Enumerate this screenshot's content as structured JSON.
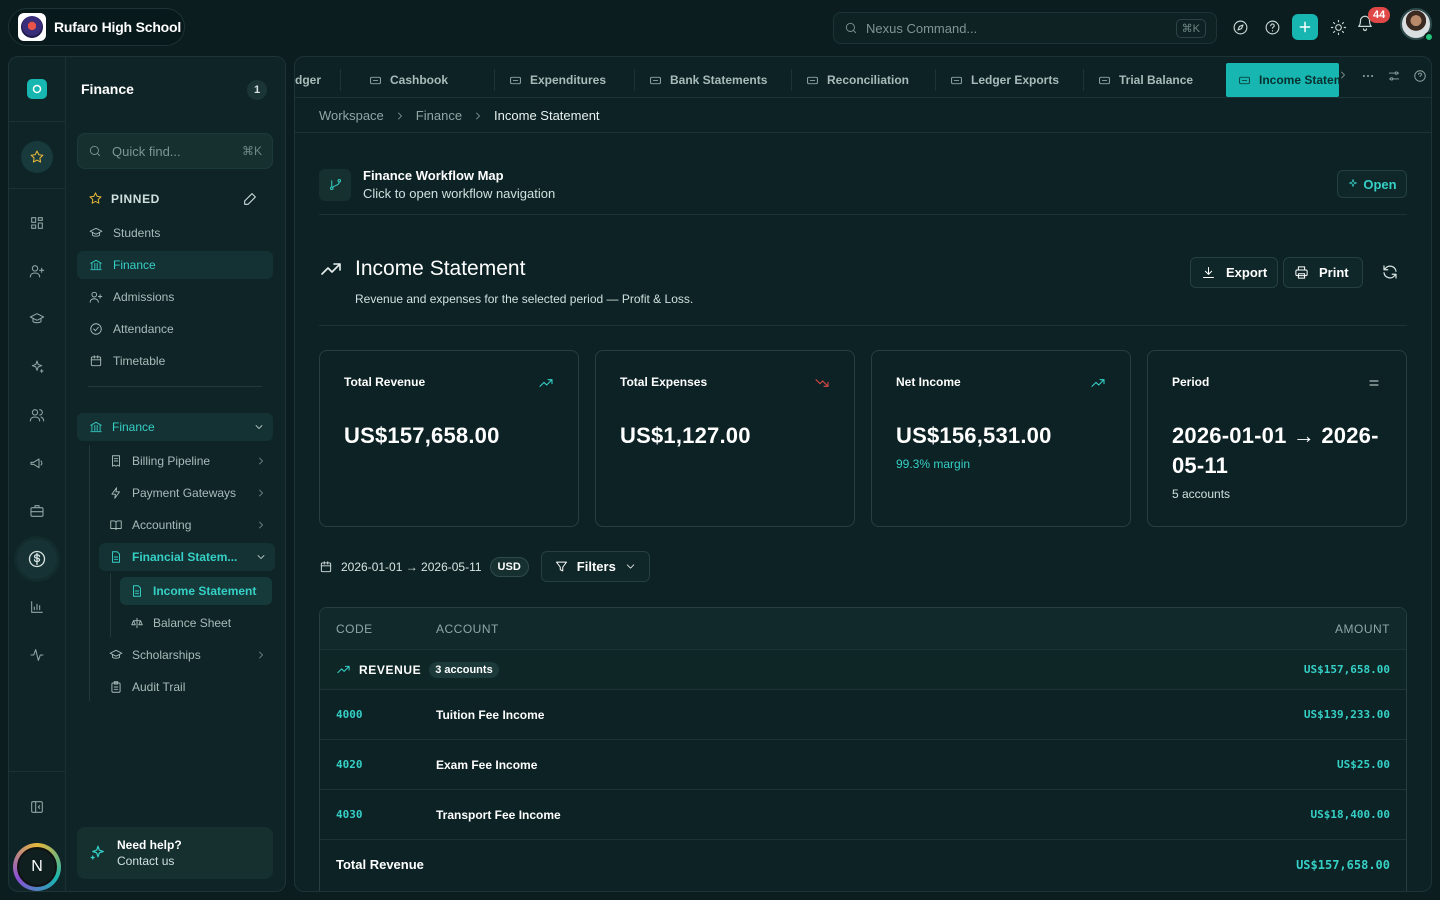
{
  "topbar": {
    "school_name": "Rufaro High School",
    "command_placeholder": "Nexus Command...",
    "command_shortcut": "⌘K",
    "notification_count": "44"
  },
  "nav": {
    "title": "Finance",
    "badge": "1",
    "quick_placeholder": "Quick find...",
    "quick_shortcut": "⌘K",
    "pinned_label": "PINNED",
    "pinned": [
      {
        "label": "Students",
        "icon": "graduation-cap-icon"
      },
      {
        "label": "Finance",
        "icon": "bank-icon"
      },
      {
        "label": "Admissions",
        "icon": "user-plus-icon"
      },
      {
        "label": "Attendance",
        "icon": "check-circle-icon"
      },
      {
        "label": "Timetable",
        "icon": "calendar-icon"
      }
    ],
    "group_label": "Finance",
    "tree": [
      {
        "label": "Billing Pipeline"
      },
      {
        "label": "Payment Gateways"
      },
      {
        "label": "Accounting"
      },
      {
        "label": "Financial Statem..."
      },
      {
        "label": "Income Statement"
      },
      {
        "label": "Balance Sheet"
      },
      {
        "label": "Scholarships"
      },
      {
        "label": "Audit Trail"
      }
    ],
    "help_title": "Need help?",
    "help_sub": "Contact us",
    "user_initial": "N"
  },
  "tabs": [
    {
      "label": "dger"
    },
    {
      "label": "Cashbook"
    },
    {
      "label": "Expenditures"
    },
    {
      "label": "Bank Statements"
    },
    {
      "label": "Reconciliation"
    },
    {
      "label": "Ledger Exports"
    },
    {
      "label": "Trial Balance"
    },
    {
      "label": "Income Statem"
    }
  ],
  "breadcrumb": [
    "Workspace",
    "Finance",
    "Income Statement"
  ],
  "workflow": {
    "title": "Finance Workflow Map",
    "subtitle": "Click to open workflow navigation",
    "open_label": "Open"
  },
  "page": {
    "title": "Income Statement",
    "subtitle": "Revenue and expenses for the selected period — Profit & Loss.",
    "export_label": "Export",
    "print_label": "Print"
  },
  "cards": [
    {
      "label": "Total Revenue",
      "value": "US$157,658.00",
      "sub": "",
      "trend": "up"
    },
    {
      "label": "Total Expenses",
      "value": "US$1,127.00",
      "sub": "",
      "trend": "down"
    },
    {
      "label": "Net Income",
      "value": "US$156,531.00",
      "sub": "99.3% margin",
      "trend": "up"
    },
    {
      "label": "Period",
      "value": "2026-01-01 → 2026-05-11",
      "sub": "5 accounts",
      "trend": "equal"
    }
  ],
  "filters": {
    "date_range": "2026-01-01 → 2026-05-11",
    "currency": "USD",
    "filters_label": "Filters"
  },
  "table": {
    "headers": {
      "code": "CODE",
      "account": "ACCOUNT",
      "amount": "AMOUNT"
    },
    "group": {
      "label": "REVENUE",
      "count": "3 accounts",
      "amount": "US$157,658.00"
    },
    "rows": [
      {
        "code": "4000",
        "account": "Tuition Fee Income",
        "amount": "US$139,233.00"
      },
      {
        "code": "4020",
        "account": "Exam Fee Income",
        "amount": "US$25.00"
      },
      {
        "code": "4030",
        "account": "Transport Fee Income",
        "amount": "US$18,400.00"
      }
    ],
    "total": {
      "label": "Total Revenue",
      "amount": "US$157,658.00"
    }
  },
  "colors": {
    "accent": "#17b6b0",
    "accent_text": "#35d0c6",
    "background": "#0b1d1f",
    "danger": "#e04848",
    "star": "#e7b73a"
  }
}
